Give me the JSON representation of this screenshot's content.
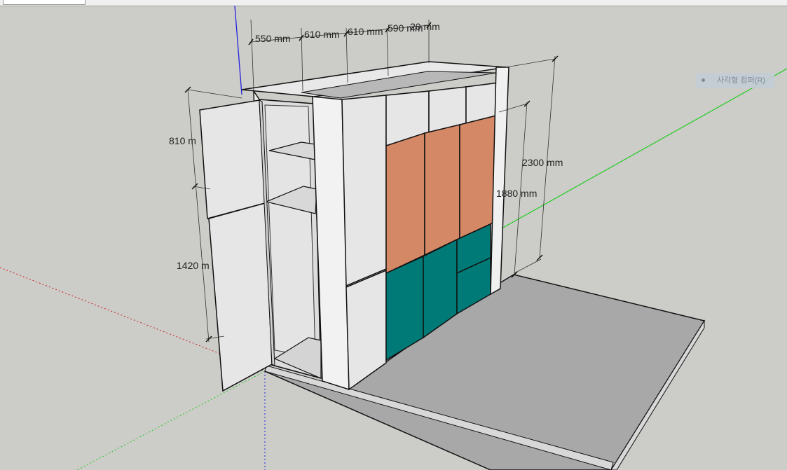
{
  "toolbar": {
    "field_value": ""
  },
  "tooltip": {
    "label": "사각형 컴퍼(R)"
  },
  "dimensions": {
    "top": [
      "550 mm",
      "610 mm",
      "610 mm",
      "590 mm",
      "20 mm"
    ],
    "left_upper": "810 m",
    "left_lower": "1420 m",
    "height_total": "2300 mm",
    "height_inner": "1880 mm"
  },
  "colors": {
    "background": "#ccccc8",
    "panel": "#e6e6e6",
    "orange_door": "#d58865",
    "teal_door": "#007a77",
    "floor": "#a8a8a8",
    "axis_green": "#22cc22",
    "axis_blue": "#2222dd",
    "axis_red": "#cc2222"
  }
}
